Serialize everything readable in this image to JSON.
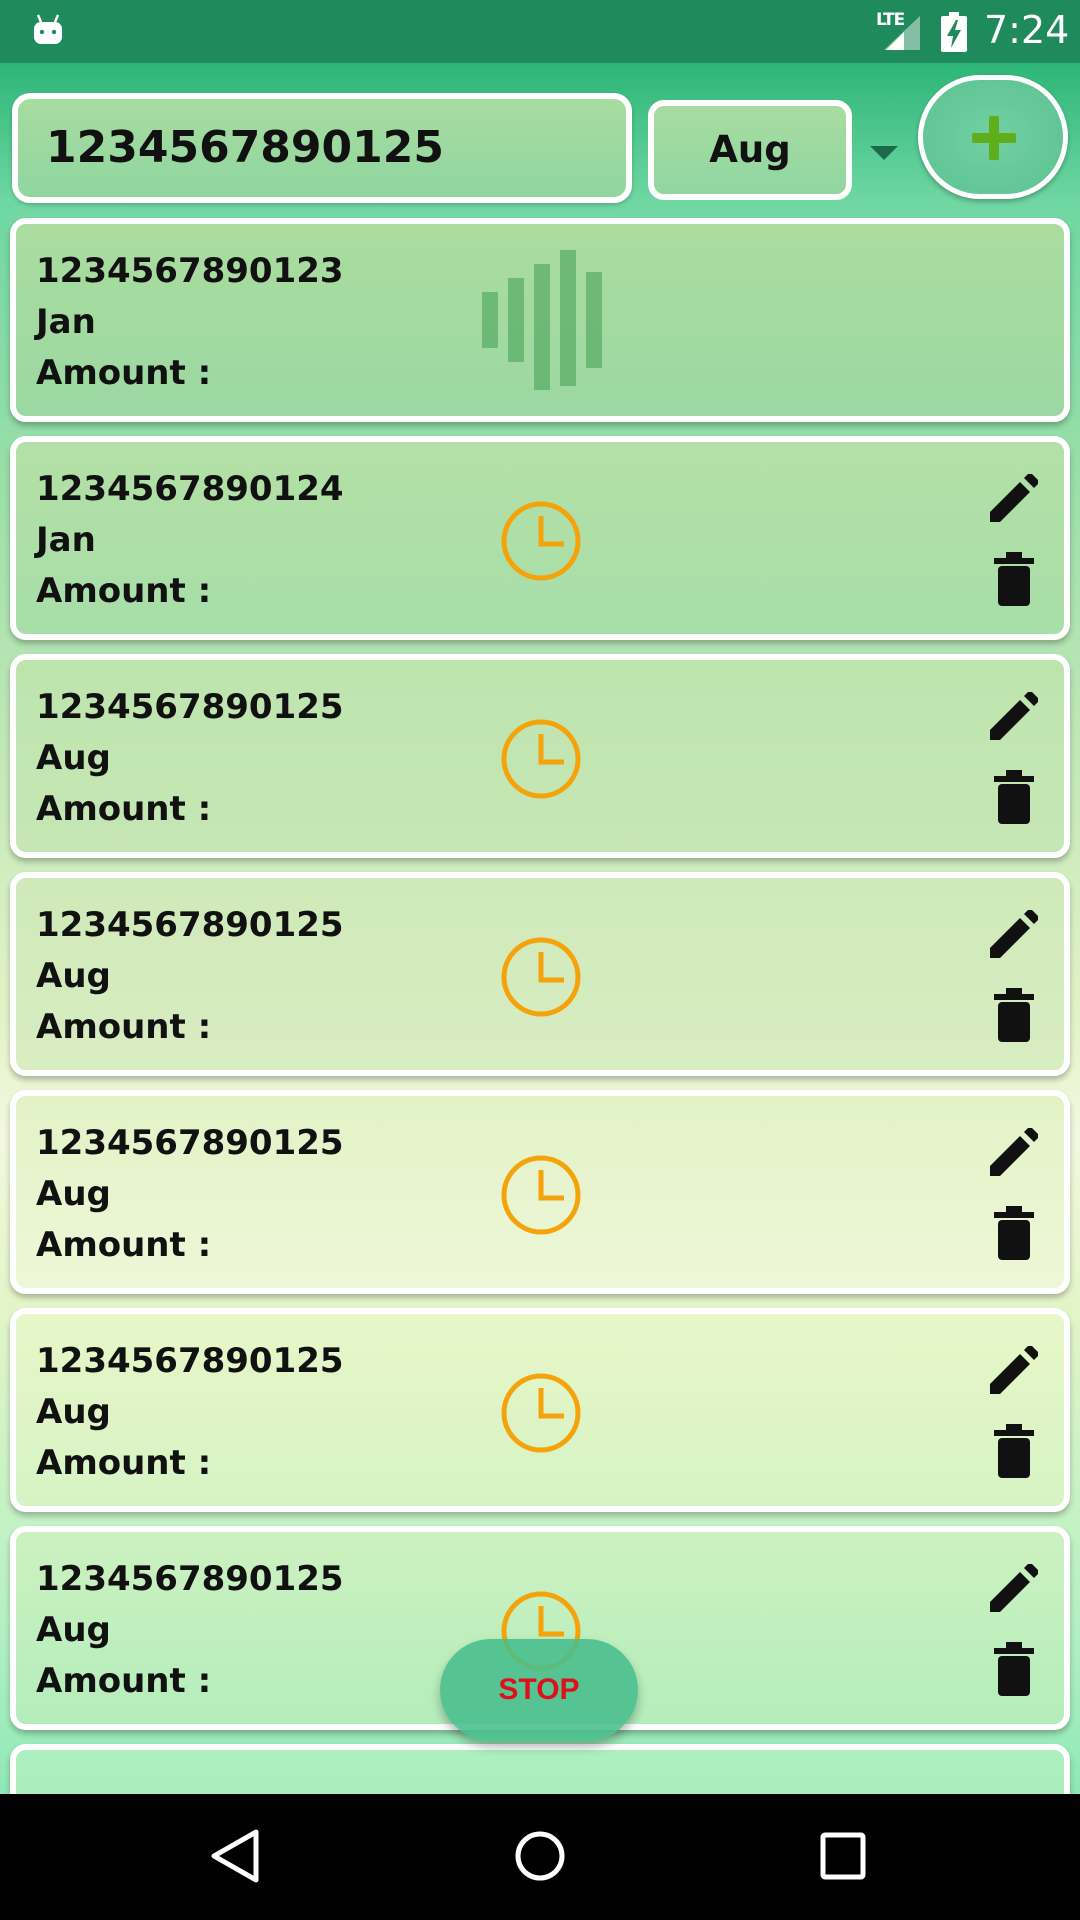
{
  "status_bar": {
    "network": "LTE",
    "time": "7:24"
  },
  "toolbar": {
    "search_value": "1234567890125",
    "month_selected": "Aug",
    "add_icon": "plus-icon"
  },
  "list": {
    "items": [
      {
        "number": "1234567890123",
        "month": "Jan",
        "amount_label": "Amount :",
        "state_icon": "audio-bars-icon",
        "actions": false
      },
      {
        "number": "1234567890124",
        "month": "Jan",
        "amount_label": "Amount :",
        "state_icon": "clock-icon",
        "actions": true
      },
      {
        "number": "1234567890125",
        "month": "Aug",
        "amount_label": "Amount :",
        "state_icon": "clock-icon",
        "actions": true
      },
      {
        "number": "1234567890125",
        "month": "Aug",
        "amount_label": "Amount :",
        "state_icon": "clock-icon",
        "actions": true
      },
      {
        "number": "1234567890125",
        "month": "Aug",
        "amount_label": "Amount :",
        "state_icon": "clock-icon",
        "actions": true
      },
      {
        "number": "1234567890125",
        "month": "Aug",
        "amount_label": "Amount :",
        "state_icon": "clock-icon",
        "actions": true
      },
      {
        "number": "1234567890125",
        "month": "Aug",
        "amount_label": "Amount :",
        "state_icon": "clock-icon",
        "actions": true
      }
    ]
  },
  "fab": {
    "stop_label": "STOP"
  },
  "colors": {
    "status_bar": "#1f8a5b",
    "clock_orange": "#f4a30a",
    "bars_green": "#5fb06a",
    "plus_green": "#5fae1c",
    "stop_red": "#e0101a"
  }
}
